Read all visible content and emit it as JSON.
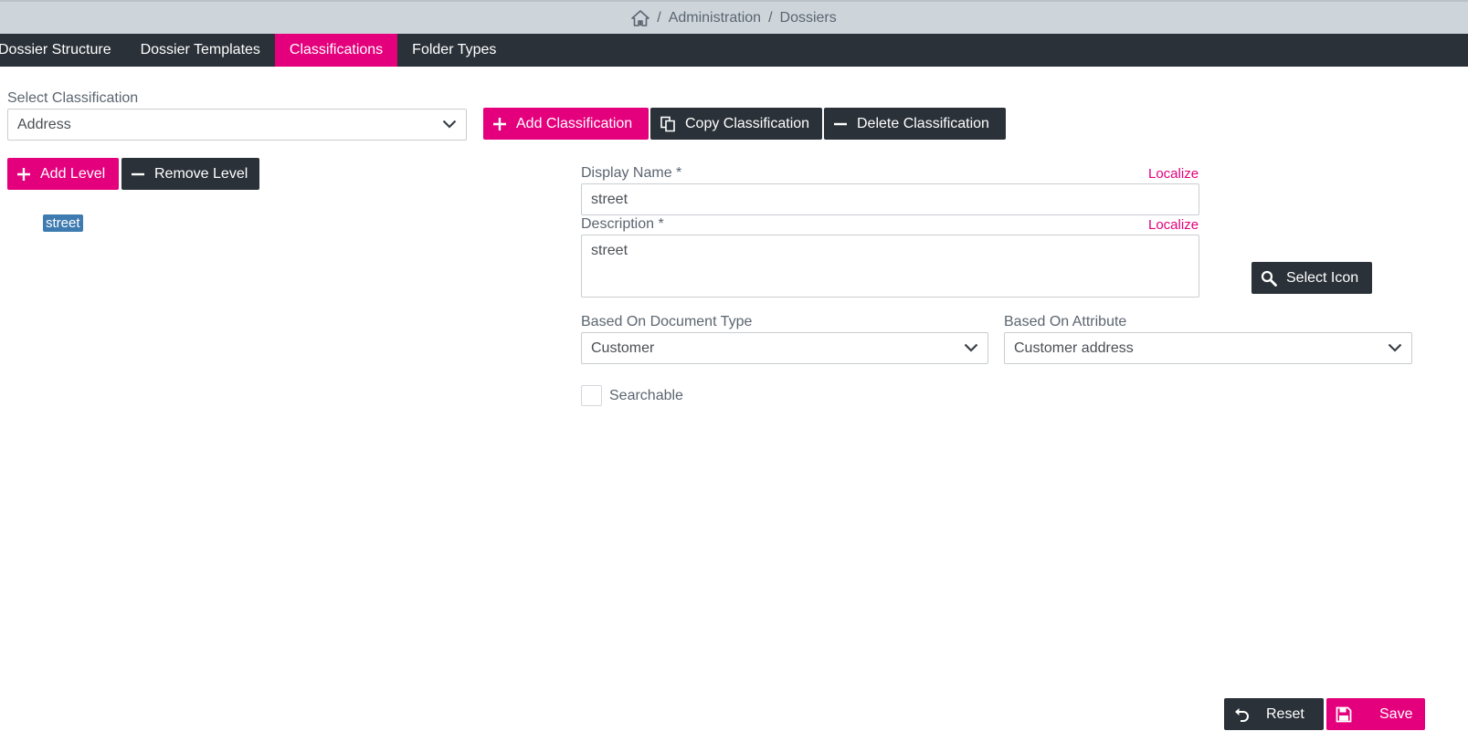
{
  "breadcrumb": {
    "separator": "/",
    "items": [
      "Administration",
      "Dossiers"
    ]
  },
  "tabs": [
    {
      "label": "Dossier Structure",
      "active": false
    },
    {
      "label": "Dossier Templates",
      "active": false
    },
    {
      "label": "Classifications",
      "active": true
    },
    {
      "label": "Folder Types",
      "active": false
    }
  ],
  "classification": {
    "label": "Select Classification",
    "value": "Address"
  },
  "actions": {
    "add_classification": "Add Classification",
    "copy_classification": "Copy Classification",
    "delete_classification": "Delete Classification",
    "add_level": "Add Level",
    "remove_level": "Remove Level"
  },
  "tree": {
    "nodes": [
      "street"
    ]
  },
  "form": {
    "display_name_label": "Display Name *",
    "display_name_value": "street",
    "description_label": "Description *",
    "description_value": "street",
    "localize": "Localize",
    "select_icon": "Select Icon",
    "doc_type_label": "Based On Document Type",
    "doc_type_value": "Customer",
    "attribute_label": "Based On Attribute",
    "attribute_value": "Customer address",
    "searchable_label": "Searchable",
    "searchable_checked": false
  },
  "footer": {
    "reset": "Reset",
    "save": "Save"
  },
  "colors": {
    "accent": "#e4007c",
    "dark": "#2a3138",
    "breadcrumb_bg": "#cdd5db",
    "tree_selected": "#3e7bb0"
  }
}
